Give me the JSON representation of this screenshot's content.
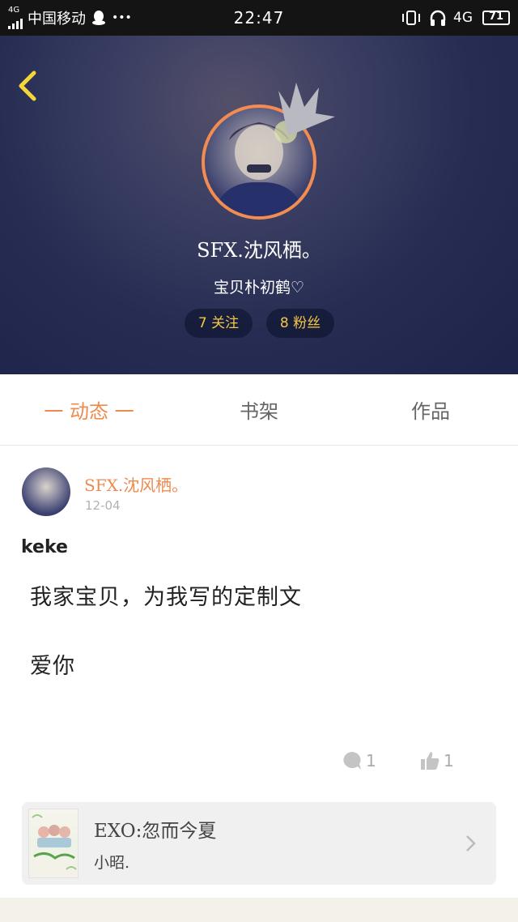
{
  "status_bar": {
    "carrier": "中国移动",
    "network_small": "4G",
    "dots": "•••",
    "time": "22:47",
    "network": "4G",
    "battery": "71"
  },
  "header": {
    "username": "SFX.沈风栖。",
    "bio": "宝贝朴初鹤♡",
    "following": "7 关注",
    "followers": "8 粉丝",
    "accent_color": "#f3c646",
    "avatar_ring_color": "#f28c50"
  },
  "tabs": [
    {
      "label": "一 动态 一",
      "active": true
    },
    {
      "label": "书架",
      "active": false
    },
    {
      "label": "作品",
      "active": false
    }
  ],
  "post": {
    "author": "SFX.沈风栖。",
    "date": "12-04",
    "title": "keke",
    "lines": [
      "我家宝贝，为我写的定制文",
      "爱你"
    ],
    "comments": "1",
    "likes": "1",
    "book": {
      "title": "EXO:忽而今夏",
      "author": "小昭."
    }
  },
  "colors": {
    "accent": "#ee8a4e",
    "tab_inactive": "#666666",
    "muted": "#aaaaaa"
  }
}
